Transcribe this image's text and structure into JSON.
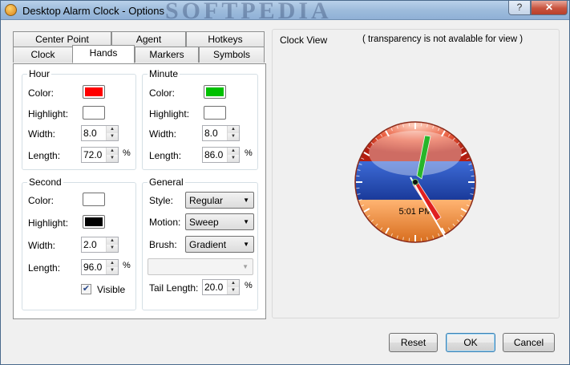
{
  "window": {
    "title": "Desktop Alarm Clock - Options",
    "watermark": "SOFTPEDIA",
    "help_label": "?",
    "close_label": "✕"
  },
  "tabs": {
    "row1": [
      "Center Point",
      "Agent",
      "Hotkeys"
    ],
    "row2": [
      "Clock",
      "Hands",
      "Markers",
      "Symbols"
    ],
    "active": "Hands"
  },
  "hour": {
    "title": "Hour",
    "color_label": "Color:",
    "highlight_label": "Highlight:",
    "width_label": "Width:",
    "length_label": "Length:",
    "color": "#ff0000",
    "highlight": "#ffffff",
    "width": "8.0",
    "length": "72.0",
    "length_unit": "%"
  },
  "minute": {
    "title": "Minute",
    "color_label": "Color:",
    "highlight_label": "Highlight:",
    "width_label": "Width:",
    "length_label": "Length:",
    "color": "#00c000",
    "highlight": "#ffffff",
    "width": "8.0",
    "length": "86.0",
    "length_unit": "%"
  },
  "second": {
    "title": "Second",
    "color_label": "Color:",
    "highlight_label": "Highlight:",
    "width_label": "Width:",
    "length_label": "Length:",
    "color": "#ffffff",
    "highlight": "#000000",
    "width": "2.0",
    "length": "96.0",
    "length_unit": "%",
    "visible_label": "Visible",
    "visible_checked": true
  },
  "general": {
    "title": "General",
    "style_label": "Style:",
    "style_value": "Regular",
    "motion_label": "Motion:",
    "motion_value": "Sweep",
    "brush_label": "Brush:",
    "brush_value": "Gradient",
    "tail_label": "Tail Length:",
    "tail_value": "20.0",
    "tail_unit": "%"
  },
  "clock_view": {
    "title": "Clock View",
    "note": "( transparency is not avalable for view )",
    "time_text": "5:01 PM",
    "icons": [
      "clock-face-icon"
    ]
  },
  "buttons": {
    "reset": "Reset",
    "ok": "OK",
    "cancel": "Cancel"
  }
}
